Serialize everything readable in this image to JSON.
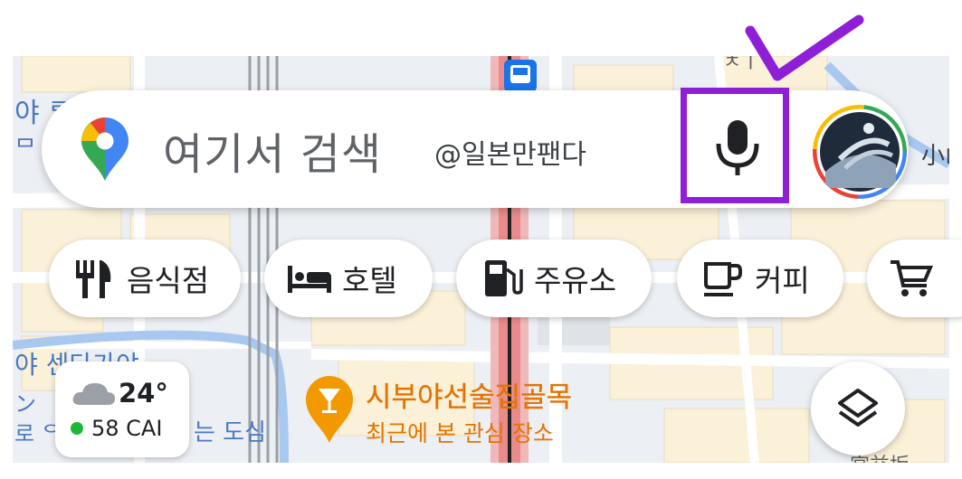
{
  "search": {
    "placeholder": "여기서 검색"
  },
  "watermark": "@일본만팬다",
  "chips": [
    {
      "label": "음식점",
      "icon": "restaurant-icon"
    },
    {
      "label": "호텔",
      "icon": "hotel-bed-icon"
    },
    {
      "label": "주유소",
      "icon": "gas-station-icon"
    },
    {
      "label": "커피",
      "icon": "coffee-cup-icon"
    },
    {
      "label": "",
      "icon": "shopping-cart-icon"
    }
  ],
  "weather": {
    "temperature": "24°",
    "aqi": "58 CAI",
    "icon": "cloud-icon",
    "aqi_color": "#1db83a"
  },
  "place": {
    "name": "시부야선술집골목",
    "subtitle": "최근에 본 관심 장소",
    "icon": "cocktail-pin-icon",
    "color": "#e37400"
  },
  "map_labels": {
    "top_partial": "ㅊㅣ",
    "left_1": "야 ᄅ",
    "left_2": "ᄆ ᄀ",
    "left_3": "야 센다가야",
    "left_4": "ン",
    "left_5": "로 ᄋ",
    "right_1": "小山",
    "poi_suffix": "는 도심",
    "bottom_right": "宮益坂"
  },
  "annotation": {
    "color": "#8f1fd6",
    "marks": [
      "checkmark-annotation",
      "highlight-box"
    ]
  },
  "colors": {
    "accent_blue": "#1a73e8",
    "transit_red": "#d93025",
    "map_road": "#ffffff",
    "map_block": "#fbf1d8"
  }
}
